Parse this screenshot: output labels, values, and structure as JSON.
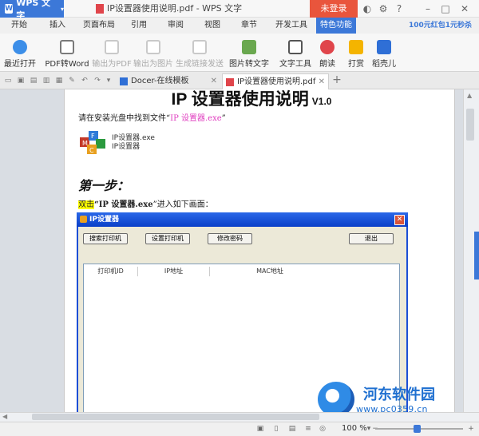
{
  "window": {
    "app_button": "WPS 文字",
    "doc_title": "IP设置器使用说明.pdf - WPS 文字",
    "login": "未登录"
  },
  "tabs": [
    "开始",
    "插入",
    "页面布局",
    "引用",
    "审阅",
    "视图",
    "章节",
    "开发工具",
    "特色功能"
  ],
  "active_tab": "特色功能",
  "promo": "100元红包1元秒杀",
  "ribbon": [
    {
      "label": "最近打开",
      "icon": "cloud-icon",
      "enabled": true,
      "color": "#3c8ee8"
    },
    {
      "label": "PDF转Word",
      "icon": "pdf-to-word-icon",
      "enabled": true,
      "color": "#7a7a7a"
    },
    {
      "label": "输出为PDF",
      "icon": "export-pdf-icon",
      "enabled": false,
      "color": "#c9c9c9"
    },
    {
      "label": "输出为图片",
      "icon": "export-image-icon",
      "enabled": false,
      "color": "#c9c9c9"
    },
    {
      "label": "生成链接发送",
      "icon": "share-link-icon",
      "enabled": false,
      "color": "#c9c9c9"
    },
    {
      "label": "图片转文字",
      "icon": "image-to-text-icon",
      "enabled": true,
      "color": "#6aa84f"
    },
    {
      "label": "文字工具",
      "icon": "text-tool-icon",
      "enabled": true,
      "color": "#555555"
    },
    {
      "label": "朗读",
      "icon": "read-aloud-icon",
      "enabled": true,
      "color": "#e0454b"
    },
    {
      "label": "打赏",
      "icon": "reward-icon",
      "enabled": true,
      "color": "#f4b400"
    },
    {
      "label": "稻壳儿",
      "icon": "docer-icon",
      "enabled": true,
      "color": "#2f6fd6"
    }
  ],
  "doc_tabs": [
    {
      "label": "Docer-在线模板",
      "active": false
    },
    {
      "label": "IP设置器使用说明.pdf",
      "active": true
    }
  ],
  "document": {
    "heading": "IP 设置器使用说明",
    "version": "V1.0",
    "line1_pre": "请在安装光盘中找到文件“",
    "line1_file": "IP 设置器.exe",
    "line1_post": "”",
    "exe_label_1": "IP设置器.exe",
    "exe_label_2": "IP设置器",
    "step1": "第一步：",
    "line2_hl": "双击",
    "line2_bold": "“IP 设置器.exe",
    "line2_post": "”进入如下画面："
  },
  "dialog": {
    "title": "IP设置器",
    "buttons": [
      "搜索打印机",
      "设置打印机",
      "修改密码",
      "退出"
    ],
    "columns": [
      "打印机ID",
      "IP地址",
      "MAC地址"
    ]
  },
  "watermark": {
    "name": "河东软件园",
    "url": "www.pc0359.cn"
  },
  "status": {
    "zoom": "100 %"
  }
}
